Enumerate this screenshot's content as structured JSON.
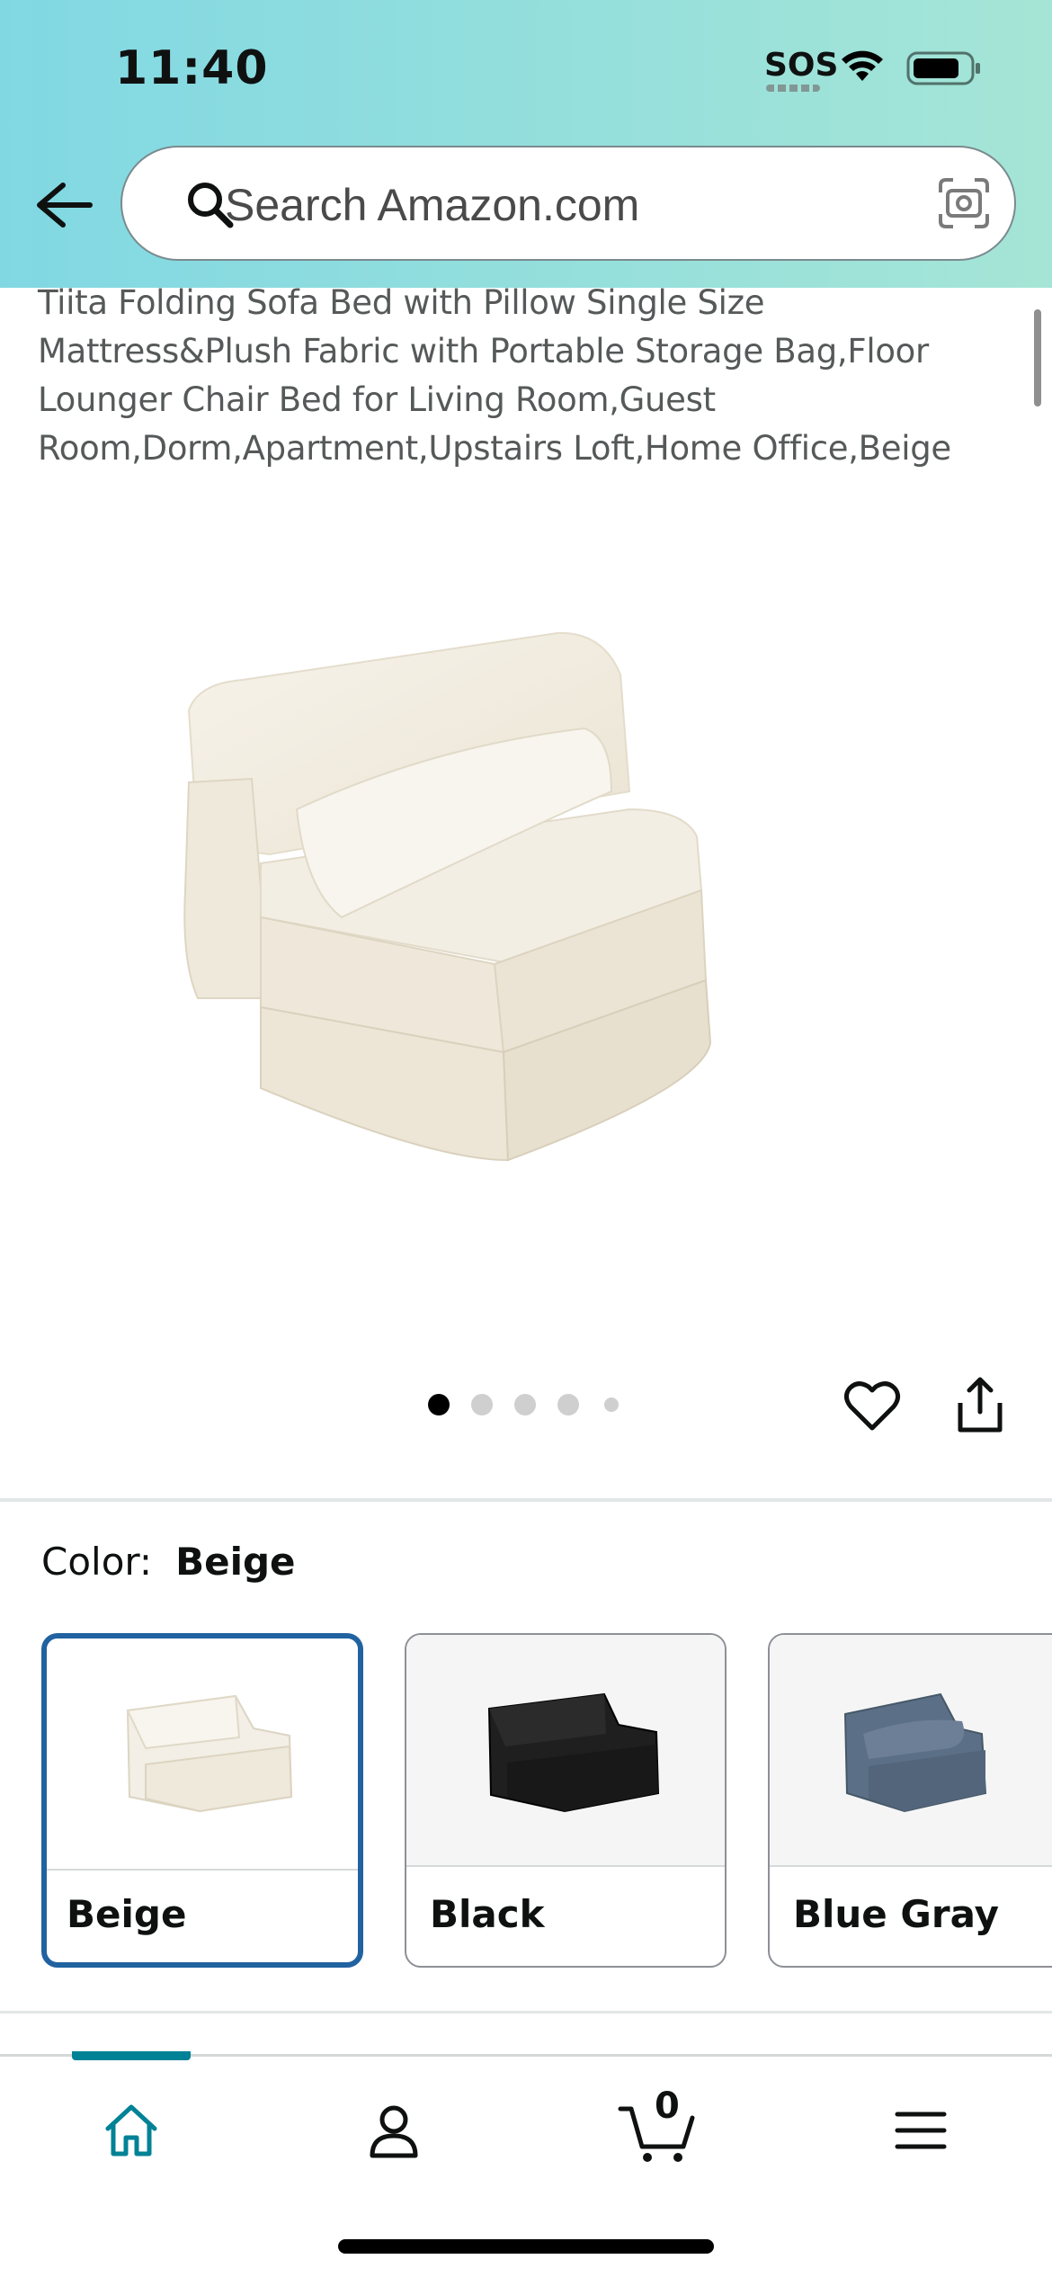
{
  "status_bar": {
    "time": "11:40",
    "sos": "SOS"
  },
  "search": {
    "placeholder": "Search Amazon.com"
  },
  "product": {
    "title": "Tiita Folding Sofa Bed with Pillow Single Size Mattress&Plush Fabric with Portable Storage Bag,Floor Lounger Chair Bed for Living Room,Guest Room,Dorm,Apartment,Upstairs Loft,Home Office,Beige",
    "image_count": 5,
    "image_index": 1
  },
  "color": {
    "label": "Color:",
    "selected": "Beige",
    "options": [
      {
        "name": "Beige",
        "swatch_color": "#f3efe6"
      },
      {
        "name": "Black",
        "swatch_color": "#1f1f1f"
      },
      {
        "name": "Blue Gray",
        "swatch_color": "#5b6f86"
      }
    ]
  },
  "bottom_nav": {
    "cart_count": "0",
    "items": [
      "home-icon",
      "account-icon",
      "cart-icon",
      "menu-icon"
    ]
  },
  "colors": {
    "header_left": "#81d8e3",
    "header_right": "#a5e5d6",
    "accent": "#008296",
    "selected_border": "#2162a1"
  }
}
